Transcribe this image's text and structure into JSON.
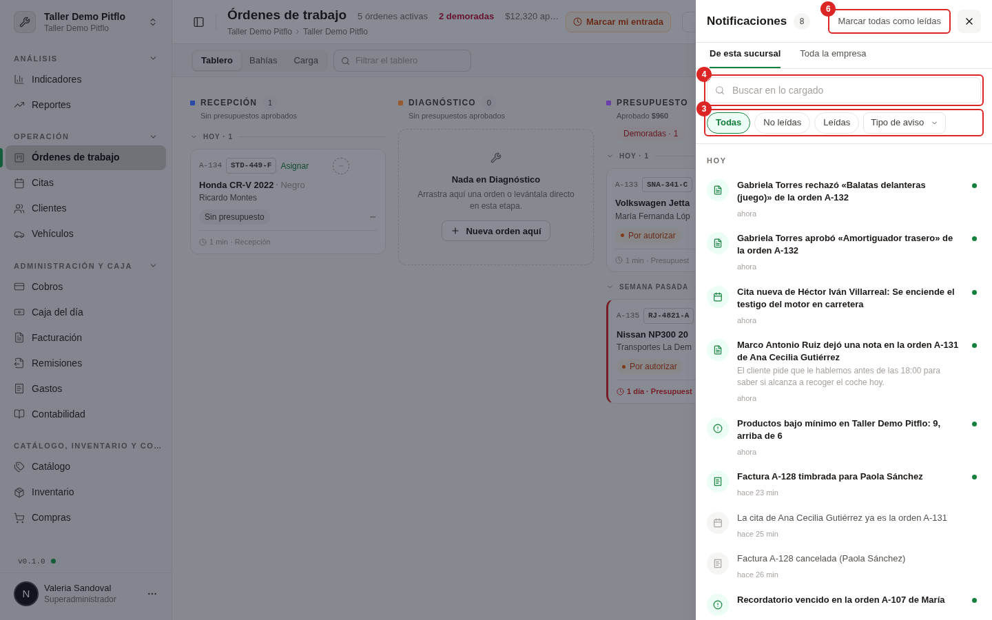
{
  "sidebar": {
    "workspace": {
      "name": "Taller Demo Pitflo",
      "subtitle": "Taller Demo Pitflo"
    },
    "sections": [
      {
        "title": "ANÁLISIS",
        "items": [
          {
            "label": "Indicadores",
            "selected": false
          },
          {
            "label": "Reportes",
            "selected": false
          }
        ]
      },
      {
        "title": "OPERACIÓN",
        "items": [
          {
            "label": "Órdenes de trabajo",
            "selected": true
          },
          {
            "label": "Citas",
            "selected": false
          },
          {
            "label": "Clientes",
            "selected": false
          },
          {
            "label": "Vehículos",
            "selected": false
          }
        ]
      },
      {
        "title": "ADMINISTRACIÓN Y CAJA",
        "items": [
          {
            "label": "Cobros",
            "selected": false
          },
          {
            "label": "Caja del día",
            "selected": false
          },
          {
            "label": "Facturación",
            "selected": false
          },
          {
            "label": "Remisiones",
            "selected": false
          },
          {
            "label": "Gastos",
            "selected": false
          },
          {
            "label": "Contabilidad",
            "selected": false
          }
        ]
      },
      {
        "title": "CATÁLOGO, INVENTARIO Y CO…",
        "items": [
          {
            "label": "Catálogo",
            "selected": false
          },
          {
            "label": "Inventario",
            "selected": false
          },
          {
            "label": "Compras",
            "selected": false
          }
        ]
      }
    ],
    "version": "v0.1.0",
    "user": {
      "initial": "N",
      "name": "Valeria Sandoval",
      "role": "Superadministrador"
    }
  },
  "header": {
    "title": "Órdenes de trabajo",
    "summary": [
      {
        "text": "5 órdenes activas",
        "alert": false
      },
      {
        "text": "2 demoradas",
        "alert": true
      },
      {
        "text": "$12,320 ap…",
        "alert": false
      }
    ],
    "breadcrumb": [
      "Taller Demo Pitflo",
      "Taller Demo Pitflo"
    ],
    "clock_in_button": "Marcar mi entrada"
  },
  "toolbar": {
    "tabs": [
      {
        "label": "Tablero",
        "selected": true
      },
      {
        "label": "Bahías",
        "selected": false
      },
      {
        "label": "Carga",
        "selected": false
      }
    ],
    "filter": {
      "placeholder": "Filtrar el tablero"
    }
  },
  "columns": [
    {
      "title": "RECEPCIÓN",
      "color": "#2b4aa8",
      "count": "1",
      "subtitle": "Sin presupuestos aprobados",
      "groups": [
        {
          "label": "HOY · 1",
          "cards": [
            {
              "id": "A-134",
              "plate": "STD-449-F",
              "assign": "Asignar",
              "vehicle": "Honda CR-V 2022",
              "vehicle_color": "Negro",
              "client": "Ricardo Montes",
              "status": {
                "kind": "neutral",
                "label": "Sin presupuesto"
              },
              "footer": "1 min · Recepción",
              "overdue": false
            }
          ]
        }
      ]
    },
    {
      "title": "DIAGNÓSTICO",
      "color": "#9a5a2e",
      "count": "0",
      "subtitle": "Sin presupuestos aprobados",
      "empty": {
        "title": "Nada en Diagnóstico",
        "text": "Arrastra aquí una orden o levántala directo en esta etapa.",
        "button": "Nueva orden aquí"
      }
    },
    {
      "title": "PRESUPUESTO",
      "color": "#6b3fa8",
      "subtitle": "Aprobado **$960**",
      "late_badge": "Demoradas · 1",
      "groups": [
        {
          "label": "HOY · 1",
          "cards": [
            {
              "id": "A-133",
              "plate": "SNA-341-C",
              "vehicle": "Volkswagen Jetta",
              "client": "María Fernanda Lóp",
              "status": {
                "kind": "pending",
                "label": "Por autorizar"
              },
              "footer": "1 min · Presupuest",
              "overdue": false
            }
          ]
        },
        {
          "label": "SEMANA PASADA",
          "cards": [
            {
              "id": "A-135",
              "plate": "RJ-4821-A",
              "vehicle": "Nissan NP300 20",
              "client": "Transportes La Dem",
              "status": {
                "kind": "pending",
                "label": "Por autorizar"
              },
              "footer": "1 día · Presupuest",
              "overdue": true
            }
          ]
        }
      ]
    }
  ],
  "notifications": {
    "title": "Notificaciones",
    "count": "8",
    "mark_all": {
      "label": "Marcar todas como leídas",
      "annotation": "6"
    },
    "tabs": [
      {
        "label": "De esta sucursal",
        "selected": true
      },
      {
        "label": "Toda la empresa",
        "selected": false
      }
    ],
    "search": {
      "placeholder": "Buscar en lo cargado",
      "annotation": "4"
    },
    "filters": {
      "annotation": "3",
      "chips": [
        {
          "label": "Todas",
          "selected": true
        },
        {
          "label": "No leídas",
          "selected": false
        },
        {
          "label": "Leídas",
          "selected": false
        }
      ],
      "type_dropdown": "Tipo de aviso"
    },
    "section": "HOY",
    "items": [
      {
        "kind": "document",
        "title": "Gabriela Torres rechazó «Balatas delanteras (juego)» de la orden A-132",
        "time": "ahora",
        "unread": true
      },
      {
        "kind": "document",
        "title": "Gabriela Torres aprobó «Amortiguador trasero» de la orden A-132",
        "time": "ahora",
        "unread": true
      },
      {
        "kind": "calendar",
        "title": "Cita nueva de Héctor Iván Villarreal: Se enciende el testigo del motor en carretera",
        "time": "ahora",
        "unread": true
      },
      {
        "kind": "document",
        "title": "Marco Antonio Ruiz dejó una nota en la orden A-131 de Ana Cecilia Gutiérrez",
        "detail": "El cliente pide que le hablemos antes de las 18:00 para saber si alcanza a recoger el coche hoy.",
        "time": "ahora",
        "unread": true
      },
      {
        "kind": "alert",
        "title": "Productos bajo mínimo en Taller Demo Pitflo: 9, arriba de 6",
        "time": "ahora",
        "unread": true
      },
      {
        "kind": "invoice",
        "title": "Factura A-128 timbrada para Paola Sánchez",
        "time": "hace 23 min",
        "unread": true
      },
      {
        "kind": "calendar",
        "title": "La cita de Ana Cecilia Gutiérrez ya es la orden A-131",
        "time": "hace 25 min",
        "unread": false
      },
      {
        "kind": "invoice",
        "title": "Factura A-128 cancelada (Paola Sánchez)",
        "time": "hace 26 min",
        "unread": false
      },
      {
        "kind": "alert",
        "title": "Recordatorio vencido en la orden A-107 de María",
        "unread": true
      }
    ]
  }
}
